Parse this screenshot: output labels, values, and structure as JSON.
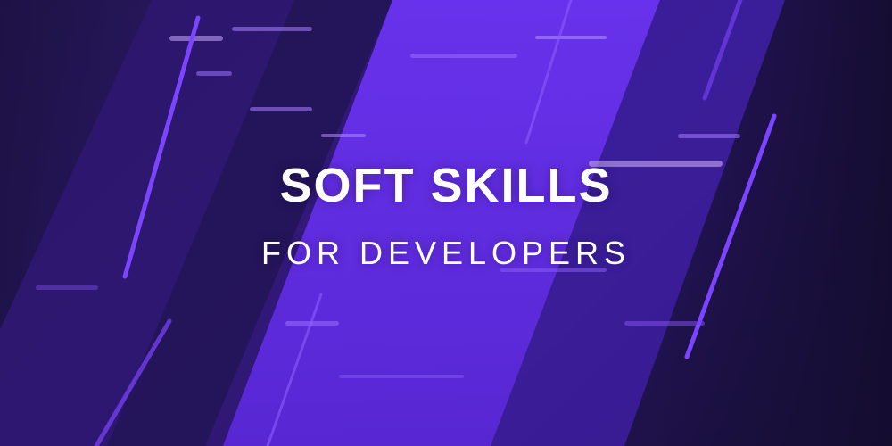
{
  "banner": {
    "title": "SOFT SKILLS",
    "subtitle": "FOR DEVELOPERS",
    "colors": {
      "background_dark": "#1b1240",
      "stripe_bright": "#6a2ff0",
      "stripe_mid": "#4a21b8",
      "line_accent": "#7b45ff",
      "text": "#ffffff"
    }
  }
}
